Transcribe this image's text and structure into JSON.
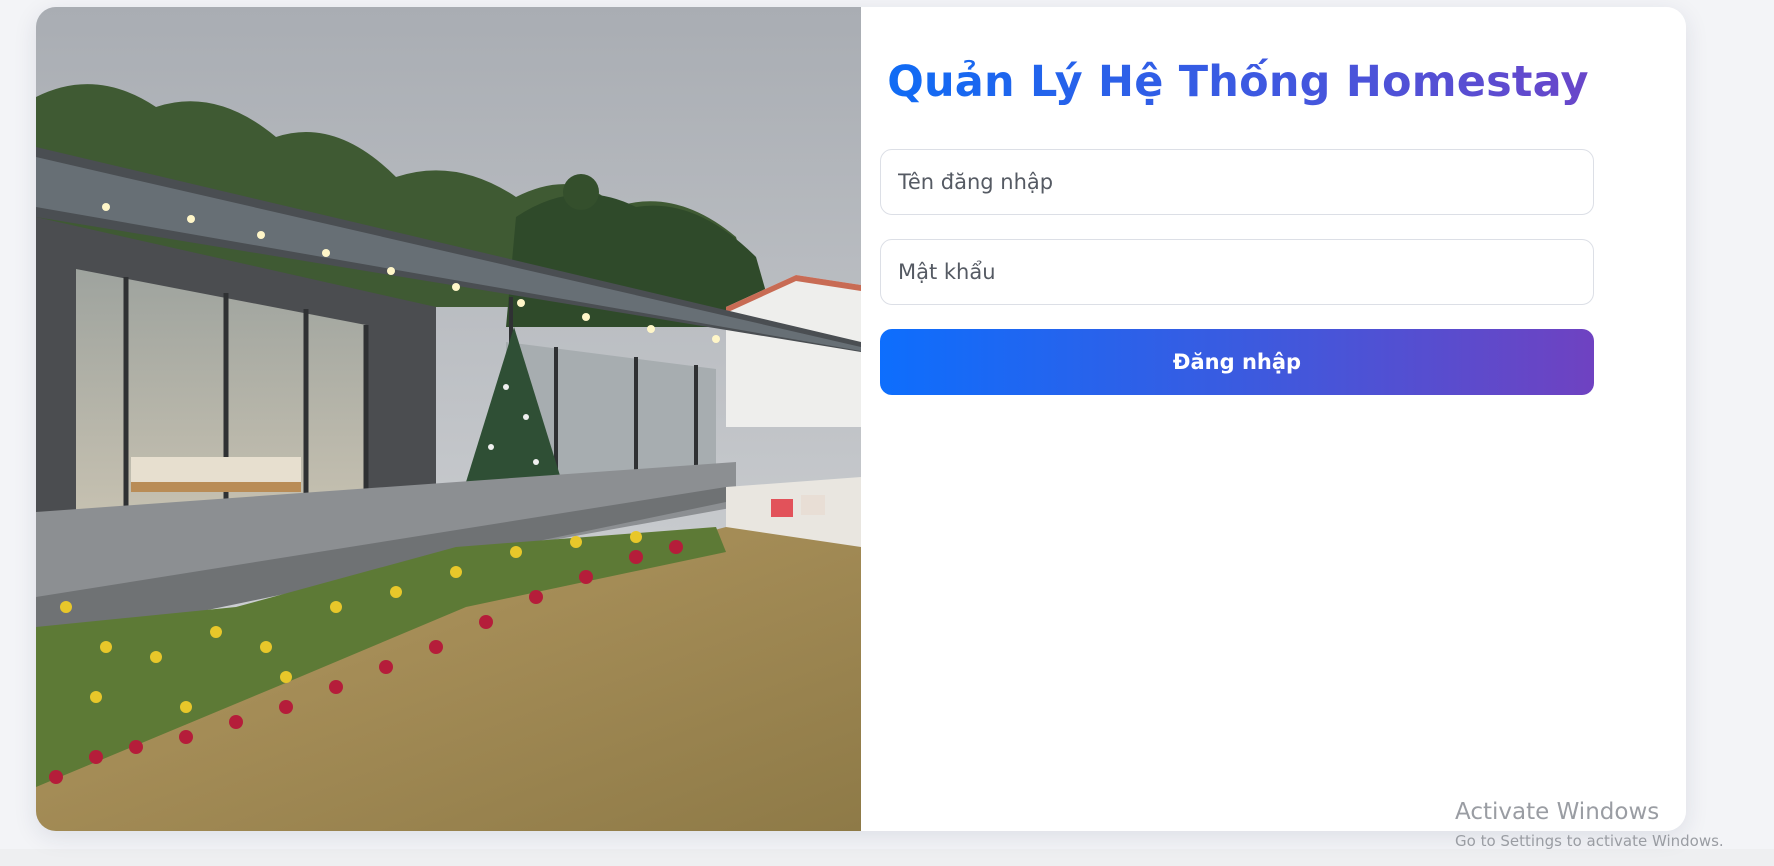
{
  "login": {
    "title": "Quản Lý Hệ Thống Homestay",
    "username_placeholder": "Tên đăng nhập",
    "password_placeholder": "Mật khẩu",
    "submit_label": "Đăng nhập"
  },
  "watermark": {
    "title": "Activate Windows",
    "subtitle": "Go to Settings to activate Windows."
  },
  "colors": {
    "gradient_start": "#0d6efd",
    "gradient_end": "#6f42c1",
    "background": "#f3f4f7",
    "card": "#ffffff"
  }
}
